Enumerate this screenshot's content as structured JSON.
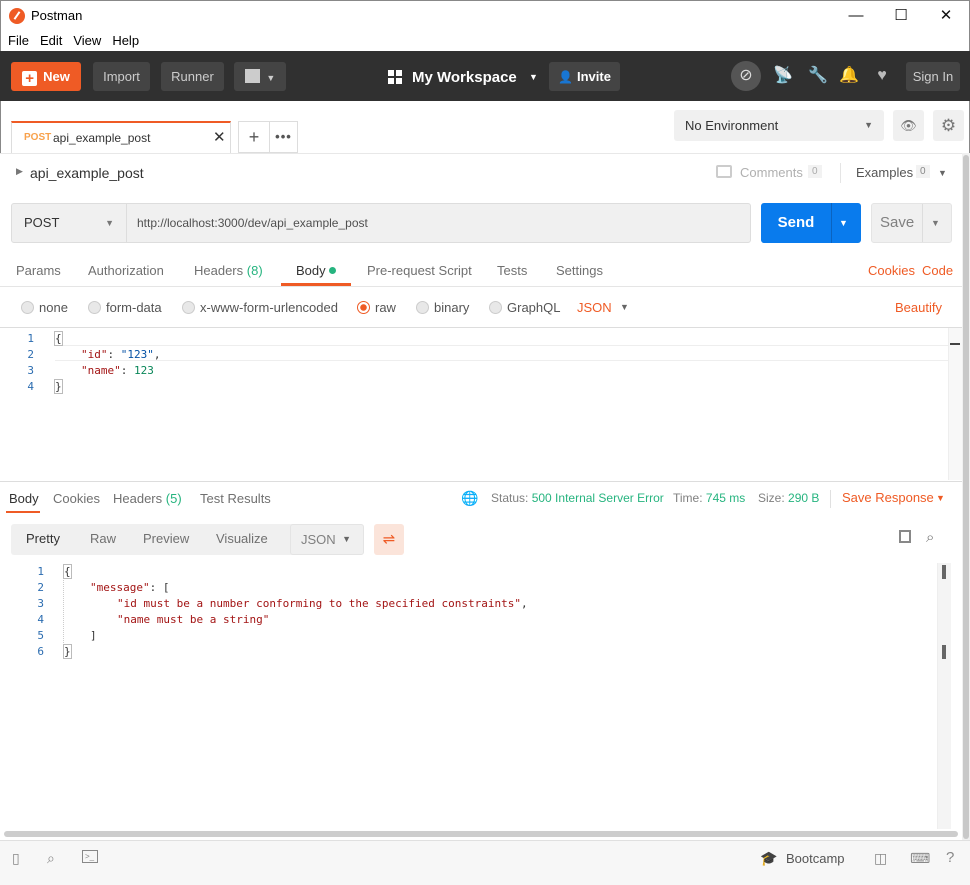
{
  "window": {
    "title": "Postman",
    "minimize": "—",
    "maximize": "☐",
    "close": "✕"
  },
  "menu": [
    "File",
    "Edit",
    "View",
    "Help"
  ],
  "header": {
    "new_label": "New",
    "import_label": "Import",
    "runner_label": "Runner",
    "workspace_label": "My Workspace",
    "invite_label": "Invite",
    "signin_label": "Sign In"
  },
  "tab": {
    "method": "POST",
    "name": "api_example_post"
  },
  "environment": {
    "selected": "No Environment"
  },
  "request": {
    "title": "api_example_post",
    "comments_label": "Comments",
    "comments_count": "0",
    "examples_label": "Examples",
    "examples_count": "0",
    "method": "POST",
    "url": "http://localhost:3000/dev/api_example_post",
    "send_label": "Send",
    "save_label": "Save"
  },
  "request_tabs": {
    "params": "Params",
    "authorization": "Authorization",
    "headers": "Headers",
    "headers_count": "(8)",
    "body": "Body",
    "prerequest": "Pre-request Script",
    "tests": "Tests",
    "settings": "Settings",
    "cookies": "Cookies",
    "code": "Code"
  },
  "body_types": {
    "none": "none",
    "form_data": "form-data",
    "urlencoded": "x-www-form-urlencoded",
    "raw": "raw",
    "binary": "binary",
    "graphql": "GraphQL",
    "format": "JSON",
    "beautify": "Beautify"
  },
  "request_body": {
    "lines": [
      "1",
      "2",
      "3",
      "4"
    ],
    "l1": "{",
    "l2_key": "\"id\"",
    "l2_colon": ": ",
    "l2_val": "\"123\"",
    "l2_end": ",",
    "l3_key": "\"name\"",
    "l3_colon": ": ",
    "l3_val": "123",
    "l4": "}"
  },
  "response_tabs": {
    "body": "Body",
    "cookies": "Cookies",
    "headers": "Headers",
    "headers_count": "(5)",
    "test_results": "Test Results"
  },
  "response_meta": {
    "status_label": "Status:",
    "status_value": "500 Internal Server Error",
    "time_label": "Time:",
    "time_value": "745 ms",
    "size_label": "Size:",
    "size_value": "290 B",
    "save_response": "Save Response"
  },
  "response_view": {
    "pretty": "Pretty",
    "raw": "Raw",
    "preview": "Preview",
    "visualize": "Visualize",
    "format": "JSON"
  },
  "response_body": {
    "lines": [
      "1",
      "2",
      "3",
      "4",
      "5",
      "6"
    ],
    "l1": "{",
    "l2_key": "\"message\"",
    "l2_rest": ": [",
    "l3": "\"id must be a number conforming to the specified constraints\"",
    "l3_end": ",",
    "l4": "\"name must be a string\"",
    "l5": "]",
    "l6": "}"
  },
  "footer": {
    "bootcamp": "Bootcamp"
  },
  "colors": {
    "accent": "#ef5b25",
    "send": "#097bed",
    "success": "#26b47f",
    "header_bg": "#303030"
  }
}
